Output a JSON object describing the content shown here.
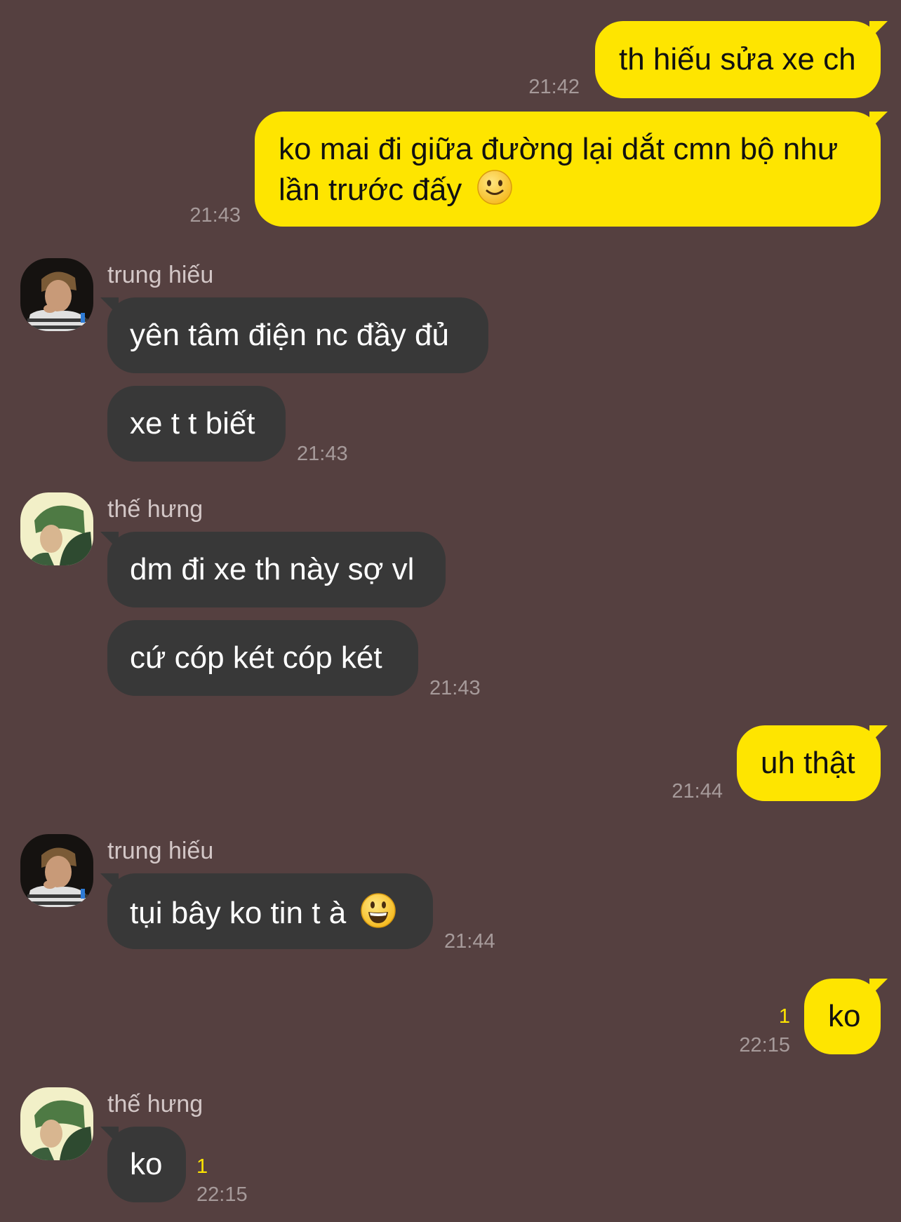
{
  "chat": {
    "colors": {
      "background": "#554040",
      "outgoing_bubble": "#FEE500",
      "incoming_bubble": "#383838",
      "timestamp": "#A69A9A",
      "unread": "#FEE500"
    },
    "messages": [
      {
        "id": "m1",
        "direction": "outgoing",
        "text": "th hiếu sửa xe ch",
        "time": "21:42"
      },
      {
        "id": "m2",
        "direction": "outgoing",
        "text": "ko mai đi giữa đường lại dắt cmn bộ như lần trước đấy",
        "emoji": "slightly-smiling-face-icon",
        "time": "21:43"
      },
      {
        "id": "m3",
        "direction": "incoming",
        "sender": "trung hiếu",
        "text": "yên tâm điện nc đầy đủ"
      },
      {
        "id": "m4",
        "direction": "incoming",
        "sender": "trung hiếu",
        "text": "xe t t biết",
        "time": "21:43"
      },
      {
        "id": "m5",
        "direction": "incoming",
        "sender": "thế hưng",
        "text": "dm đi xe th này sợ vl"
      },
      {
        "id": "m6",
        "direction": "incoming",
        "sender": "thế hưng",
        "text": "cứ cóp két cóp két",
        "time": "21:43"
      },
      {
        "id": "m7",
        "direction": "outgoing",
        "text": "uh thật",
        "time": "21:44"
      },
      {
        "id": "m8",
        "direction": "incoming",
        "sender": "trung hiếu",
        "text": "tụi bây ko tin t à",
        "emoji": "grinning-face-icon",
        "time": "21:44"
      },
      {
        "id": "m9",
        "direction": "outgoing",
        "text": "ko",
        "unread": "1",
        "time": "22:15"
      },
      {
        "id": "m10",
        "direction": "incoming",
        "sender": "thế hưng",
        "text": "ko",
        "unread": "1",
        "time": "22:15"
      }
    ],
    "senders": {
      "g1": "trung hiếu",
      "g2": "thế hưng",
      "g3": "trung hiếu",
      "g4": "thế hưng"
    }
  }
}
